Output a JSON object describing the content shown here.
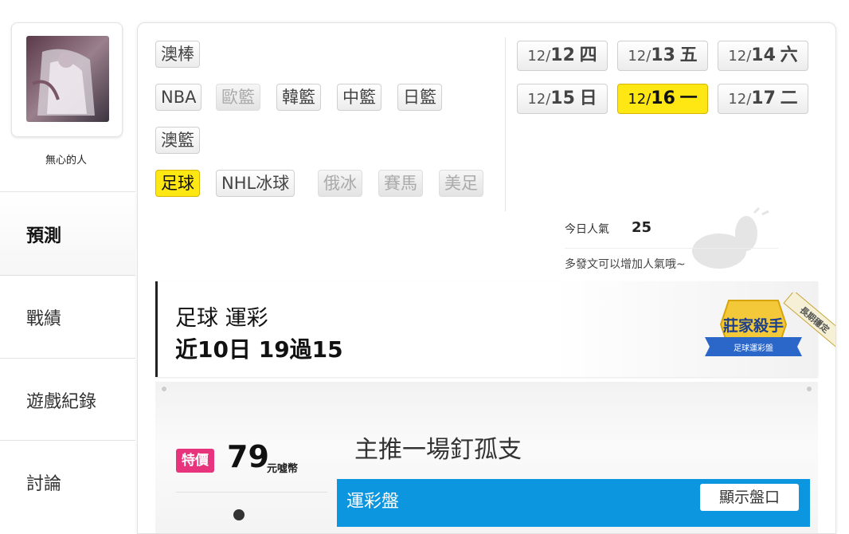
{
  "profile": {
    "username": "無心的人"
  },
  "nav": {
    "items": [
      {
        "label": "預測"
      },
      {
        "label": "戰績"
      },
      {
        "label": "遊戲紀錄"
      },
      {
        "label": "討論"
      }
    ]
  },
  "sports": {
    "row1": [
      "澳棒"
    ],
    "row2": [
      "NBA",
      "歐籃",
      "韓籃",
      "中籃",
      "日籃"
    ],
    "row3": [
      "澳籃"
    ],
    "row4": [
      "足球",
      "NHL冰球",
      "俄冰",
      "賽馬",
      "美足"
    ],
    "selected": "足球",
    "disabled": [
      "歐籃",
      "俄冰",
      "賽馬",
      "美足"
    ]
  },
  "dates": [
    {
      "month": "12/",
      "day": "12",
      "weekday": "四"
    },
    {
      "month": "12/",
      "day": "13",
      "weekday": "五"
    },
    {
      "month": "12/",
      "day": "14",
      "weekday": "六"
    },
    {
      "month": "12/",
      "day": "15",
      "weekday": "日"
    },
    {
      "month": "12/",
      "day": "16",
      "weekday": "一",
      "selected": true
    },
    {
      "month": "12/",
      "day": "17",
      "weekday": "二"
    }
  ],
  "popularity": {
    "label": "今日人氣",
    "value": "25",
    "tip": "多發文可以增加人氣哦~"
  },
  "record": {
    "title": "足球 運彩",
    "stat": "近10日 19過15"
  },
  "badge": {
    "title": "莊家殺手",
    "subtitle": "足球運彩盤",
    "ribbon": "長期穩定"
  },
  "product": {
    "sale_tag": "特價",
    "price": "79",
    "unit": "元噓幣",
    "headline": "主推一場釘孤支",
    "bar_label": "運彩盤",
    "show_button": "顯示盤口"
  },
  "colors": {
    "selected": "#ffe713",
    "sale": "#e8347d",
    "bar": "#0b96df"
  }
}
